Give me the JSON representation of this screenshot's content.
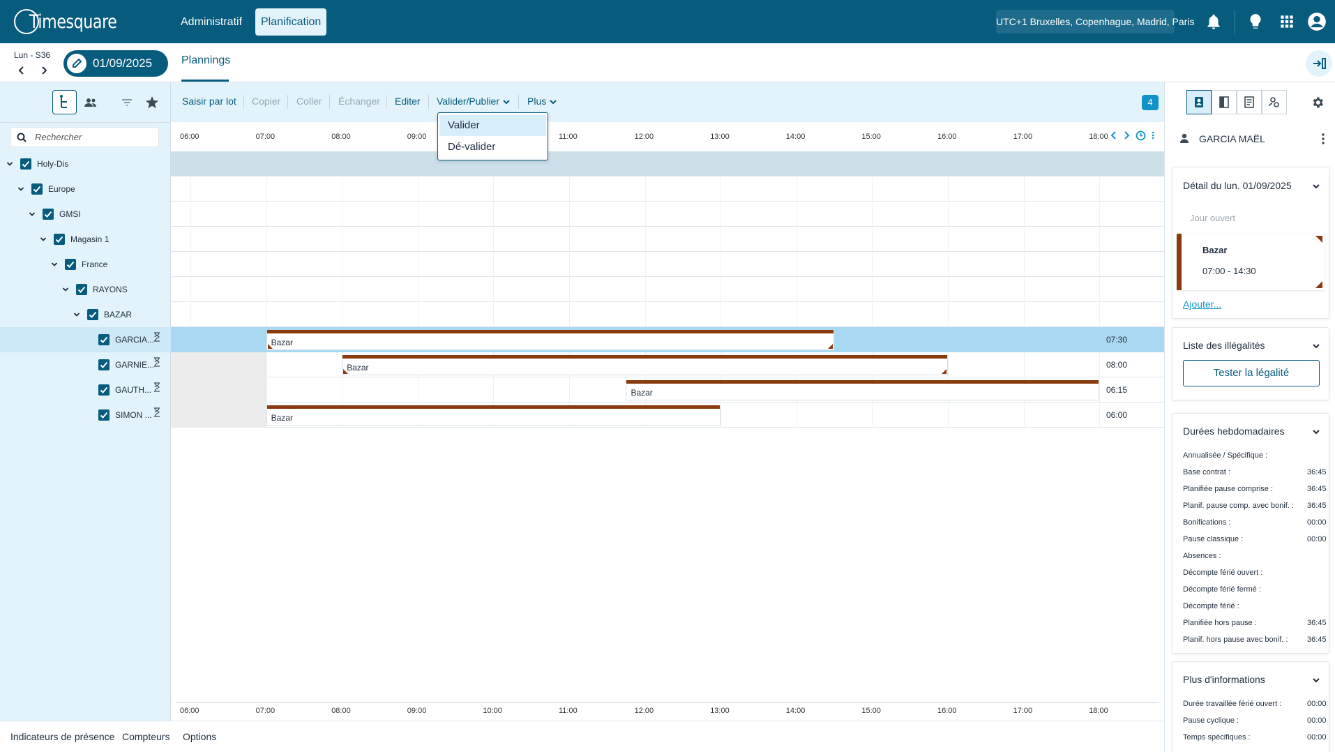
{
  "app": {
    "logo_text": "Timesquare"
  },
  "nav": {
    "administratif": "Administratif",
    "planification": "Planification"
  },
  "header": {
    "timezone": "UTC+1 Bruxelles, Copenhague, Madrid, Paris"
  },
  "date_nav": {
    "week_label": "Lun - S36",
    "date": "01/09/2025"
  },
  "tabs": {
    "plannings": "Plannings"
  },
  "search": {
    "placeholder": "Rechercher"
  },
  "tree": [
    {
      "label": "Holy-Dis",
      "level": 0
    },
    {
      "label": "Europe",
      "level": 1
    },
    {
      "label": "GMSI",
      "level": 2
    },
    {
      "label": "Magasin 1",
      "level": 3
    },
    {
      "label": "France",
      "level": 4
    },
    {
      "label": "RAYONS",
      "level": 5
    },
    {
      "label": "BAZAR",
      "level": 6
    }
  ],
  "employees": [
    {
      "label": "GARCIA...",
      "duration": "07:30",
      "shift": {
        "label": "Bazar",
        "start": "07:00",
        "end": "14:30"
      },
      "selected": true
    },
    {
      "label": "GARNIE...",
      "duration": "08:00",
      "shift": {
        "label": "Bazar",
        "start": "08:00",
        "end": "16:00"
      },
      "selected": false
    },
    {
      "label": "GAUTH...",
      "duration": "06:15",
      "shift": {
        "label": "Bazar",
        "start": "11:45",
        "end": "18:00"
      },
      "selected": false
    },
    {
      "label": "SIMON ...",
      "duration": "06:00",
      "shift": {
        "label": "Bazar",
        "start": "07:00",
        "end": "13:00"
      },
      "selected": false
    }
  ],
  "toolbar": {
    "saisir": "Saisir par lot",
    "copier": "Copier",
    "coller": "Coller",
    "echanger": "Échanger",
    "editer": "Editer",
    "valider_publier": "Valider/Publier",
    "plus": "Plus",
    "badge": "4"
  },
  "dropdown": {
    "valider": "Valider",
    "devalider": "Dé-valider"
  },
  "axis": {
    "top": [
      "06:00",
      "07:00",
      "08:00",
      "09:00",
      "10:00",
      "11:00",
      "12:00",
      "13:00",
      "14:00",
      "15:00",
      "16:00",
      "17:00",
      "18:00"
    ],
    "bottom": [
      "06:00",
      "07:00",
      "08:00",
      "09:00",
      "10:00",
      "11:00",
      "12:00",
      "13:00",
      "14:00",
      "15:00",
      "16:00",
      "17:00",
      "18:00"
    ]
  },
  "bottom_bar": {
    "presence": "Indicateurs de présence",
    "compteurs": "Compteurs",
    "options": "Options"
  },
  "right_panel": {
    "user_name": "GARCIA MAËL",
    "detail": {
      "title": "Détail du lun. 01/09/2025",
      "jour_ouvert": "Jour ouvert",
      "shift_label": "Bazar",
      "shift_time": "07:00 - 14:30",
      "ajouter": "Ajouter..."
    },
    "illegalites": {
      "title": "Liste des illégalités",
      "button": "Tester la légalité"
    },
    "durees": {
      "title": "Durées hebdomadaires",
      "rows": [
        {
          "k": "Annualisée / Spécifique :",
          "v": ""
        },
        {
          "k": "Base contrat :",
          "v": "36:45"
        },
        {
          "k": "Planifiée pause comprise :",
          "v": "36:45"
        },
        {
          "k": "Planif. pause comp. avec bonif. :",
          "v": "36:45"
        },
        {
          "k": "Bonifications :",
          "v": "00:00"
        },
        {
          "k": "Pause classique :",
          "v": "00:00"
        },
        {
          "k": "Absences :",
          "v": ""
        },
        {
          "k": "Décompte férié ouvert :",
          "v": ""
        },
        {
          "k": "Décompte férié fermé :",
          "v": ""
        },
        {
          "k": "Décompte férié :",
          "v": ""
        },
        {
          "k": "Planifiée hors pause :",
          "v": "36:45"
        },
        {
          "k": "Planif. hors pause avec bonif. :",
          "v": "36:45"
        }
      ]
    },
    "plus_infos": {
      "title": "Plus d'informations",
      "rows": [
        {
          "k": "Durée travaillée férié ouvert :",
          "v": "00:00"
        },
        {
          "k": "Pause cyclique :",
          "v": "00:00"
        },
        {
          "k": "Temps spécifiques :",
          "v": "00:00"
        }
      ]
    }
  },
  "colors": {
    "brand": "#075b7d",
    "accent_light": "#e2f3fb",
    "shift_bar": "#8b3a0f",
    "badge": "#1193c9"
  }
}
